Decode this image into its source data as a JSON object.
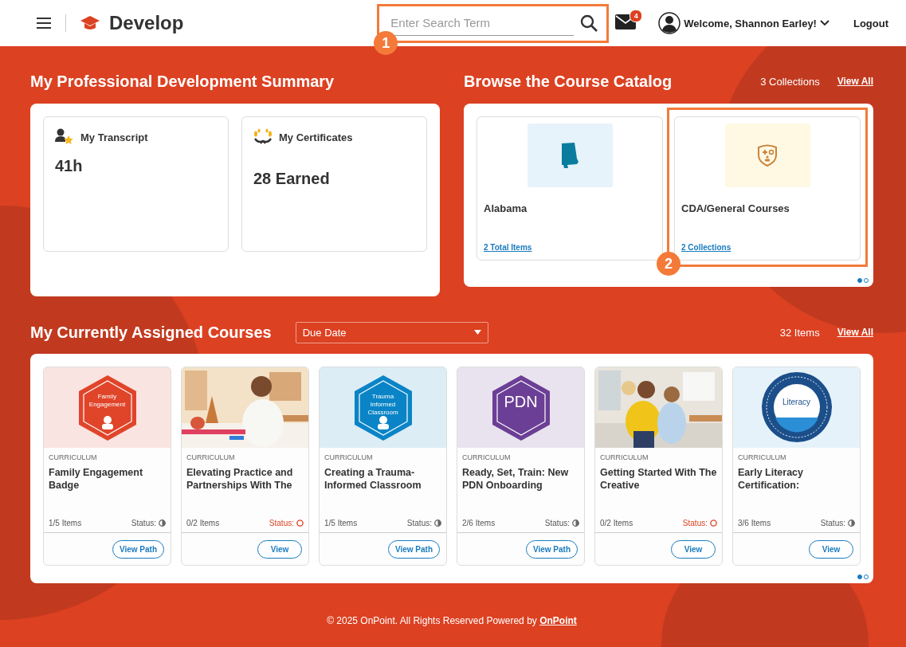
{
  "header": {
    "app_name": "Develop",
    "search": {
      "placeholder": "Enter Search Term",
      "callout": "1"
    },
    "mail_count": "4",
    "welcome": "Welcome, Shannon Earley!",
    "logout": "Logout"
  },
  "summary": {
    "title": "My Professional Development Summary",
    "tiles": [
      {
        "kind": "transcript",
        "label": "My Transcript",
        "value": "41h"
      },
      {
        "kind": "certificates",
        "label": "My Certificates",
        "value": "28 Earned"
      }
    ]
  },
  "catalog": {
    "title": "Browse the Course Catalog",
    "count": "3 Collections",
    "view_all": "View All",
    "collections": [
      {
        "kind": "state",
        "name": "Alabama",
        "link": "2 Total Items"
      },
      {
        "kind": "shield",
        "name": "CDA/General Courses",
        "link": "2 Collections",
        "callout": "2"
      }
    ],
    "dots": [
      {
        "selected": true
      },
      {
        "selected": false
      }
    ]
  },
  "courses": {
    "title": "My Currently Assigned Courses",
    "sort": "Due Date",
    "count": "32 Items",
    "view_all": "View All",
    "items": [
      {
        "art": {
          "kind": "badge",
          "text": "Family Engagement",
          "color": "#e0452a"
        },
        "category": "CURRICULUM",
        "title": "Family Engagement Badge",
        "progress": "1/5 Items",
        "status": {
          "label": "Status:",
          "kind": "in_progress"
        },
        "action": "View Path"
      },
      {
        "category": "CURRICULUM",
        "title": "Elevating Practice and Partnerships With The",
        "progress": "0/2 Items",
        "status": {
          "label": "Status:",
          "kind": "not_started"
        },
        "action": "View"
      },
      {
        "art": {
          "kind": "badge",
          "text": "Trauma Informed Classroom",
          "color": "#0a84c6"
        },
        "category": "CURRICULUM",
        "title": "Creating a Trauma-Informed Classroom",
        "progress": "1/5 Items",
        "status": {
          "label": "Status:",
          "kind": "in_progress"
        },
        "action": "View Path"
      },
      {
        "art": {
          "kind": "badge",
          "text": "PDN",
          "color": "#6b3f95"
        },
        "category": "CURRICULUM",
        "title": "Ready, Set, Train: New PDN Onboarding",
        "progress": "2/6 Items",
        "status": {
          "label": "Status:",
          "kind": "in_progress"
        },
        "action": "View Path"
      },
      {
        "category": "CURRICULUM",
        "title": "Getting Started With The Creative",
        "progress": "0/2 Items",
        "status": {
          "label": "Status:",
          "kind": "not_started"
        },
        "action": "View"
      },
      {
        "art": {
          "kind": "seal",
          "text": "Literacy",
          "color": "#1c4f8a"
        },
        "category": "CURRICULUM",
        "title": "Early Literacy Certification:",
        "progress": "3/6 Items",
        "status": {
          "label": "Status:",
          "kind": "in_progress"
        },
        "action": "View"
      }
    ],
    "dots": [
      {
        "selected": true
      },
      {
        "selected": false
      }
    ]
  },
  "footer": {
    "text": "© 2025 OnPoint. All Rights Reserved Powered by",
    "link": "OnPoint"
  }
}
